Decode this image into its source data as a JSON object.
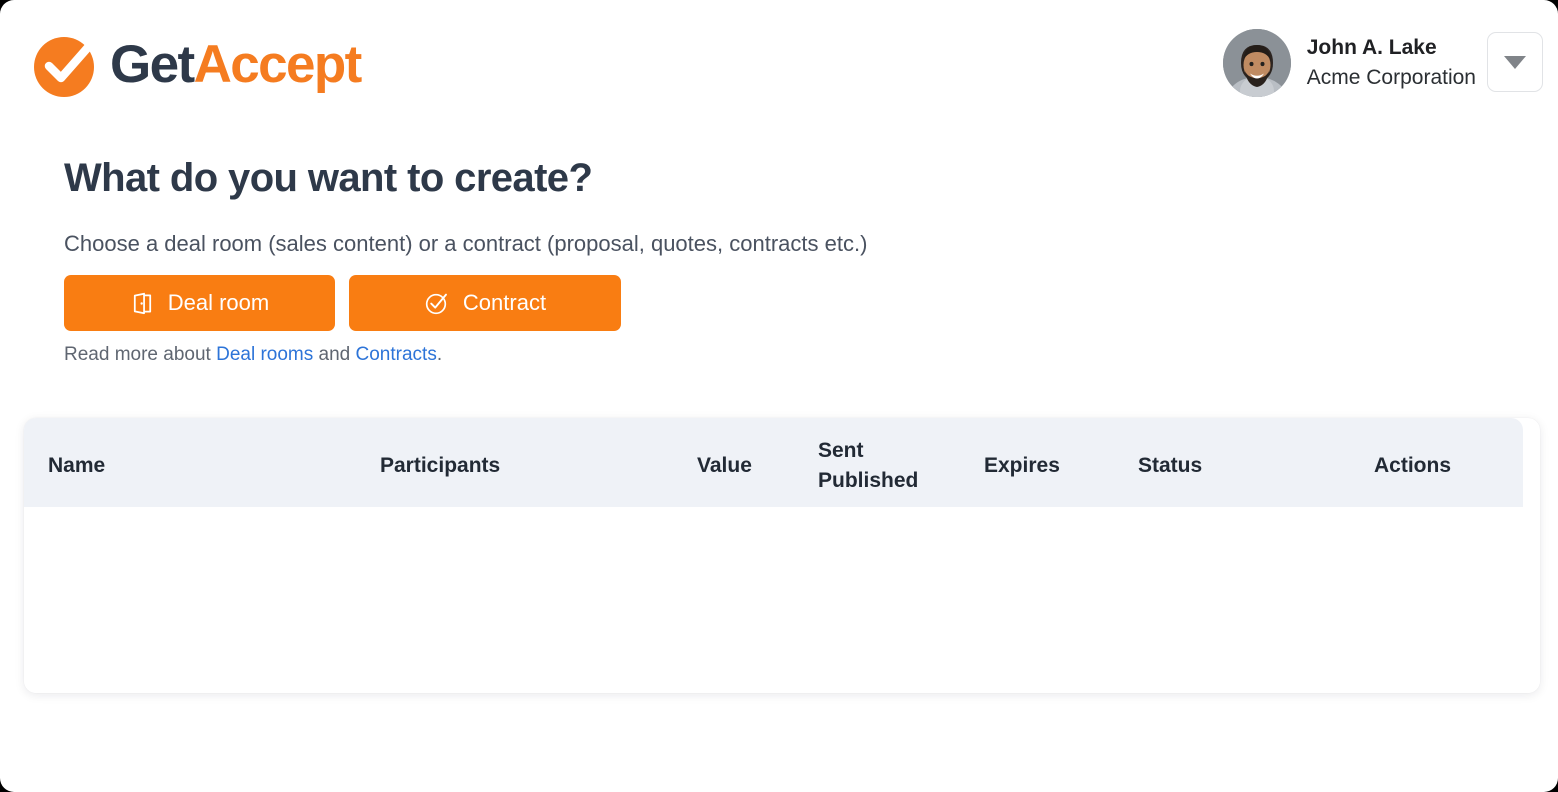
{
  "brand": {
    "logo_get": "Get",
    "logo_accept": "Accept",
    "orange": "#f97d12",
    "navy": "#2e3949",
    "link_blue": "#2d74d8"
  },
  "header": {
    "user_name": "John A. Lake",
    "user_org": "Acme Corporation",
    "avatar_icon": "user-avatar-photo",
    "dropdown_icon": "chevron-down-icon"
  },
  "main": {
    "headline": "What do you want to create?",
    "subtitle": "Choose a deal room (sales content) or a contract (proposal, quotes, contracts etc.)",
    "buttons": [
      {
        "label": "Deal room",
        "icon": "open-door-icon"
      },
      {
        "label": "Contract",
        "icon": "check-circle-icon"
      }
    ],
    "readmore": {
      "prefix": "Read more about ",
      "link1": "Deal rooms",
      "middle": " and ",
      "link2": "Contracts",
      "suffix": "."
    }
  },
  "table": {
    "columns": [
      "Name",
      "Participants",
      "Value",
      "Sent\nPublished",
      "Expires",
      "Status",
      "Actions"
    ],
    "rows": []
  }
}
